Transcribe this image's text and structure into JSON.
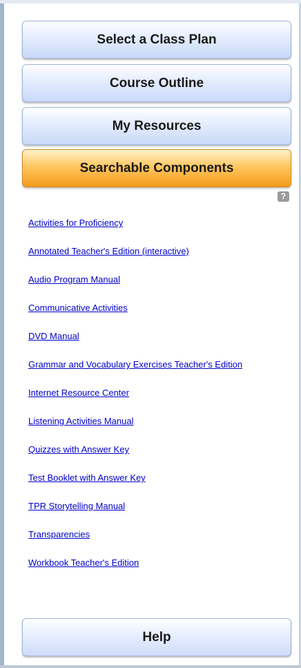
{
  "nav": {
    "select_class_plan": "Select a Class Plan",
    "course_outline": "Course Outline",
    "my_resources": "My Resources",
    "searchable_components": "Searchable Components"
  },
  "help_icon": {
    "glyph": "?",
    "icon": "question-icon"
  },
  "components": [
    "Activities for Proficiency",
    "Annotated Teacher's Edition (interactive)",
    "Audio Program Manual",
    "Communicative Activities",
    "DVD Manual",
    "Grammar and Vocabulary Exercises Teacher's Edition",
    "Internet Resource Center",
    "Listening Activities Manual",
    "Quizzes with Answer Key",
    "Test Booklet with Answer Key",
    "TPR Storytelling Manual",
    "Transparencies",
    "Workbook Teacher's Edition"
  ],
  "footer": {
    "help_label": "Help"
  },
  "colors": {
    "link": "#0000cc",
    "active_button": "#f59c1a",
    "button_blue": "#c9d9f9",
    "frame": "#9fb6cc"
  }
}
